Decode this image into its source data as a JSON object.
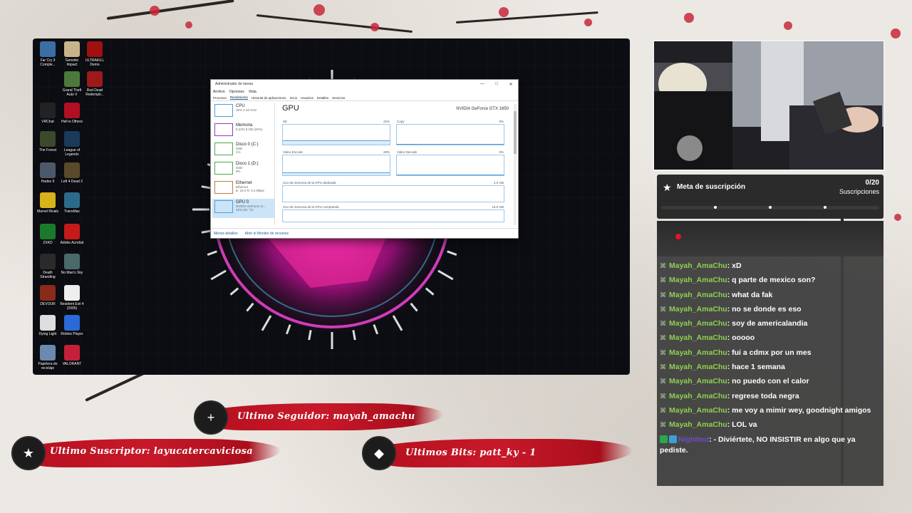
{
  "desktop_icons": [
    {
      "label": "Far Cry 3 Comple...",
      "color": "#3a6ea5"
    },
    {
      "label": "Genshin Impact",
      "color": "#c9b38a"
    },
    {
      "label": "ULTRAKILL Demo",
      "color": "#a01010"
    },
    {
      "label": "Grand Theft Auto V",
      "color": "#4d7a3a"
    },
    {
      "label": "Red Dead Redempti...",
      "color": "#9c1a1a"
    },
    {
      "label": "VRChat",
      "color": "#222222"
    },
    {
      "label": "Hell is Others",
      "color": "#b01022"
    },
    {
      "label": "The Forest",
      "color": "#3a4a2a"
    },
    {
      "label": "League of Legends",
      "color": "#1b3a5a"
    },
    {
      "label": "Hades II",
      "color": "#4a5a6a"
    },
    {
      "label": "Left 4 Dead 2",
      "color": "#5a4a2a"
    },
    {
      "label": "Marvel Rivals",
      "color": "#d9b21a"
    },
    {
      "label": "TransMac",
      "color": "#2b6a8a"
    },
    {
      "label": "ZXKD",
      "color": "#1a7a2a"
    },
    {
      "label": "Adobe Acrobat",
      "color": "#c41a1a"
    },
    {
      "label": "Death Stranding",
      "color": "#2a2a2a"
    },
    {
      "label": "No Man's Sky",
      "color": "#4a6a6a"
    },
    {
      "label": "DEVOUR",
      "color": "#8a2a1a"
    },
    {
      "label": "Resident Evil 4 (2005)",
      "color": "#eeeeee"
    },
    {
      "label": "Dying Light",
      "color": "#dddddd"
    },
    {
      "label": "Roblox Player",
      "color": "#2a6ad8"
    },
    {
      "label": "Papelera de reciclaje",
      "color": "#6a8ab0"
    },
    {
      "label": "VALORANT",
      "color": "#c4203a"
    }
  ],
  "taskmgr": {
    "title": "Administrador de tareas",
    "menu": [
      "Archivo",
      "Opciones",
      "Vista"
    ],
    "tabs": [
      "Procesos",
      "Rendimiento",
      "Historial de aplicaciones",
      "Inicio",
      "Usuarios",
      "Detalles",
      "Servicios"
    ],
    "resources": [
      {
        "name": "CPU",
        "line1": "32%  2.10 GHz",
        "line2": ""
      },
      {
        "name": "Memoria",
        "line1": "8.2/31.9 GB (26%)",
        "line2": ""
      },
      {
        "name": "Disco 0 (C:)",
        "line1": "SSD",
        "line2": "1%"
      },
      {
        "name": "Disco 1 (D:)",
        "line1": "SSD",
        "line2": "0%"
      },
      {
        "name": "Ethernet",
        "line1": "Ethernet",
        "line2": "E: 19.2  R: 0.4 Mbps"
      },
      {
        "name": "GPU 0",
        "line1": "NVIDIA GeForce G...",
        "line2": "42% (61 °C)"
      }
    ],
    "gpu_title": "GPU",
    "gpu_name": "NVIDIA GeForce GTX 1650",
    "graphs": [
      {
        "label": "3D",
        "pct": "42%",
        "level": 0.42
      },
      {
        "label": "Copy",
        "pct": "0%",
        "level": 0.0
      },
      {
        "label": "Video Encode",
        "pct": "28%",
        "level": 0.28
      },
      {
        "label": "Video Decode",
        "pct": "0%",
        "level": 0.0
      }
    ],
    "dedicated_label": "Uso de memoria de la GPU dedicada",
    "dedicated_max": "4.0 GB",
    "shared_label": "Uso de memoria de la GPU compartida",
    "shared_max": "16.0 GB",
    "footer_less": "Menos detalles",
    "footer_monitor": "Abrir el Monitor de recursos"
  },
  "subgoal": {
    "title": "Meta de suscripción",
    "count": "0/20",
    "label": "Suscripciones",
    "progress": 0.0
  },
  "chat": [
    {
      "user": "Mayah_AmaChu",
      "text": "xD"
    },
    {
      "user": "Mayah_AmaChu",
      "text": "q parte de mexico son?"
    },
    {
      "user": "Mayah_AmaChu",
      "text": "what da fak"
    },
    {
      "user": "Mayah_AmaChu",
      "text": "no se donde es eso"
    },
    {
      "user": "Mayah_AmaChu",
      "text": "soy de americalandia"
    },
    {
      "user": "Mayah_AmaChu",
      "text": "ooooo"
    },
    {
      "user": "Mayah_AmaChu",
      "text": "fui a cdmx por un mes"
    },
    {
      "user": "Mayah_AmaChu",
      "text": "hace 1 semana"
    },
    {
      "user": "Mayah_AmaChu",
      "text": "no puedo con el calor"
    },
    {
      "user": "Mayah_AmaChu",
      "text": "regrese toda negra"
    },
    {
      "user": "Mayah_AmaChu",
      "text": "me voy a mimir wey, goodnight amigos"
    },
    {
      "user": "Mayah_AmaChu",
      "text": "LOL va"
    },
    {
      "user": "Nightbot",
      "text": "- Diviértete, NO INSISTIR en algo que ya pediste.",
      "bot": true
    }
  ],
  "alerts": {
    "follower": "Ultimo Seguidor: mayah_amachu",
    "subscriber": "Ultimo Suscriptor: layucatercaviciosa",
    "bits": "Ultimos Bits: patt_ky - 1"
  }
}
